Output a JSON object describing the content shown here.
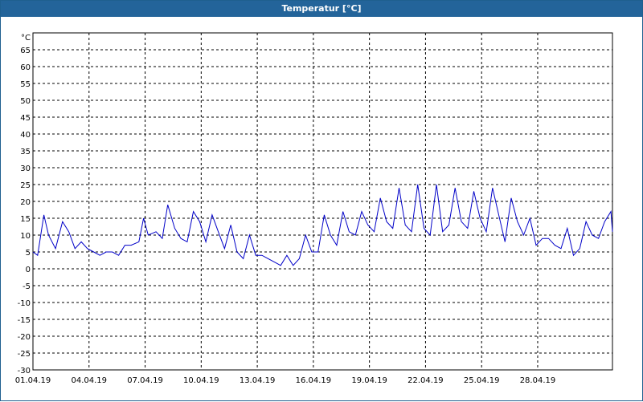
{
  "window": {
    "title": "Temperatur [°C]"
  },
  "colors": {
    "titlebar": "#23649a",
    "series": "#0000c8",
    "grid": "#000000",
    "background": "#ffffff"
  },
  "chart_data": {
    "type": "line",
    "title": "Temperatur [°C]",
    "ylabel": "°C",
    "xlabel": "",
    "ylim": [
      -30,
      70
    ],
    "yticks": [
      65,
      60,
      55,
      50,
      45,
      40,
      35,
      30,
      25,
      20,
      15,
      10,
      5,
      0,
      -5,
      -10,
      -15,
      -20,
      -25,
      -30
    ],
    "xlim": [
      "2019-04-01",
      "2019-05-02"
    ],
    "xticks": [
      "01.04.19",
      "04.04.19",
      "07.04.19",
      "10.04.19",
      "13.04.19",
      "16.04.19",
      "19.04.19",
      "22.04.19",
      "25.04.19",
      "28.04.19"
    ],
    "grid": true,
    "series": [
      {
        "x": [
          "2019-04-01T00:00",
          "2019-04-01T06:00",
          "2019-04-01T14:00",
          "2019-04-01T20:00",
          "2019-04-02T05:00",
          "2019-04-02T14:00",
          "2019-04-02T22:00",
          "2019-04-03T06:00",
          "2019-04-03T14:00",
          "2019-04-03T22:00",
          "2019-04-04T06:00",
          "2019-04-04T14:00",
          "2019-04-04T22:00",
          "2019-04-05T06:00",
          "2019-04-05T14:00",
          "2019-04-05T22:00",
          "2019-04-06T06:00",
          "2019-04-06T16:00",
          "2019-04-06T22:00",
          "2019-04-07T04:00",
          "2019-04-07T14:00",
          "2019-04-07T22:00",
          "2019-04-08T05:00",
          "2019-04-08T14:00",
          "2019-04-08T22:00",
          "2019-04-09T06:00",
          "2019-04-09T14:00",
          "2019-04-09T22:00",
          "2019-04-10T06:00",
          "2019-04-10T14:00",
          "2019-04-10T22:00",
          "2019-04-11T06:00",
          "2019-04-11T14:00",
          "2019-04-11T22:00",
          "2019-04-12T06:00",
          "2019-04-12T14:00",
          "2019-04-12T22:00",
          "2019-04-13T06:00",
          "2019-04-13T14:00",
          "2019-04-13T22:00",
          "2019-04-14T06:00",
          "2019-04-14T14:00",
          "2019-04-14T22:00",
          "2019-04-15T06:00",
          "2019-04-15T14:00",
          "2019-04-15T22:00",
          "2019-04-16T06:00",
          "2019-04-16T14:00",
          "2019-04-16T22:00",
          "2019-04-17T06:00",
          "2019-04-17T14:00",
          "2019-04-17T22:00",
          "2019-04-18T06:00",
          "2019-04-18T14:00",
          "2019-04-18T22:00",
          "2019-04-19T06:00",
          "2019-04-19T14:00",
          "2019-04-19T22:00",
          "2019-04-20T06:00",
          "2019-04-20T14:00",
          "2019-04-20T22:00",
          "2019-04-21T06:00",
          "2019-04-21T14:00",
          "2019-04-21T22:00",
          "2019-04-22T06:00",
          "2019-04-22T14:00",
          "2019-04-22T22:00",
          "2019-04-23T06:00",
          "2019-04-23T14:00",
          "2019-04-23T22:00",
          "2019-04-24T06:00",
          "2019-04-24T14:00",
          "2019-04-24T22:00",
          "2019-04-25T06:00",
          "2019-04-25T14:00",
          "2019-04-25T22:00",
          "2019-04-26T06:00",
          "2019-04-26T14:00",
          "2019-04-26T22:00",
          "2019-04-27T06:00",
          "2019-04-27T14:00",
          "2019-04-27T22:00",
          "2019-04-28T06:00",
          "2019-04-28T14:00",
          "2019-04-28T22:00",
          "2019-04-29T06:00",
          "2019-04-29T14:00",
          "2019-04-29T22:00",
          "2019-04-30T06:00",
          "2019-04-30T14:00",
          "2019-04-30T22:00",
          "2019-05-01T06:00",
          "2019-05-01T14:00",
          "2019-05-01T22:00",
          "2019-05-02T00:00"
        ],
        "values": [
          5,
          4,
          16,
          10,
          6,
          14,
          11,
          6,
          8,
          6,
          5,
          4,
          5,
          5,
          4,
          7,
          7,
          8,
          15,
          10,
          11,
          9,
          19,
          12,
          9,
          8,
          17,
          14,
          8,
          16,
          11,
          6,
          13,
          5,
          3,
          10,
          4,
          4,
          3,
          2,
          1,
          4,
          1,
          3,
          10,
          5,
          5,
          16,
          10,
          7,
          17,
          11,
          10,
          17,
          13,
          11,
          21,
          14,
          12,
          24,
          13,
          11,
          25,
          12,
          10,
          25,
          11,
          13,
          24,
          14,
          12,
          23,
          15,
          11,
          24,
          16,
          8,
          21,
          14,
          10,
          15,
          7,
          9,
          9,
          7,
          6,
          12,
          4,
          6,
          14,
          10,
          9,
          14,
          17,
          11
        ]
      }
    ]
  }
}
